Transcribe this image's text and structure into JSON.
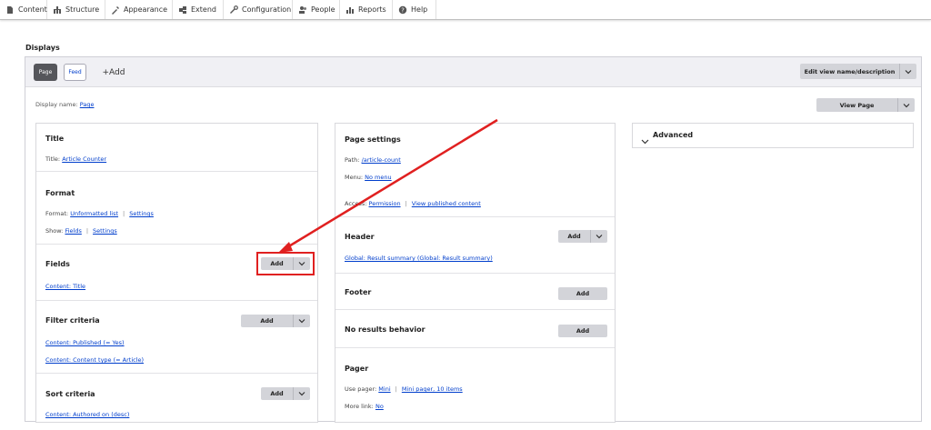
{
  "toolbar": {
    "items": [
      {
        "label": "Content",
        "icon": "content-icon"
      },
      {
        "label": "Structure",
        "icon": "structure-icon"
      },
      {
        "label": "Appearance",
        "icon": "appearance-icon"
      },
      {
        "label": "Extend",
        "icon": "extend-icon"
      },
      {
        "label": "Configuration",
        "icon": "configuration-icon"
      },
      {
        "label": "People",
        "icon": "people-icon"
      },
      {
        "label": "Reports",
        "icon": "reports-icon"
      },
      {
        "label": "Help",
        "icon": "help-icon"
      }
    ]
  },
  "displays": {
    "heading": "Displays",
    "tabs": {
      "page": "Page",
      "feed": "Feed",
      "add": "+Add"
    },
    "edit_view_button": "Edit view name/description",
    "display_name_label": "Display name:",
    "display_name_value": "Page",
    "view_page_button": "View Page"
  },
  "left": {
    "title": {
      "heading": "Title",
      "label": "Title:",
      "value": "Article Counter"
    },
    "format": {
      "heading": "Format",
      "format_label": "Format:",
      "format_value": "Unformatted list",
      "format_settings": "Settings",
      "show_label": "Show:",
      "show_value": "Fields",
      "show_settings": "Settings"
    },
    "fields": {
      "heading": "Fields",
      "add": "Add",
      "item": "Content: Title"
    },
    "filter": {
      "heading": "Filter criteria",
      "add": "Add",
      "items": [
        "Content: Published (= Yes)",
        "Content: Content type (= Article)"
      ]
    },
    "sort": {
      "heading": "Sort criteria",
      "add": "Add",
      "item": "Content: Authored on (desc)"
    }
  },
  "middle": {
    "page_settings": {
      "heading": "Page settings",
      "path_label": "Path:",
      "path_value": "/article-count",
      "menu_label": "Menu:",
      "menu_value": "No menu",
      "access_label": "Access:",
      "access_value": "Permission",
      "access_extra": "View published content"
    },
    "header": {
      "heading": "Header",
      "add": "Add",
      "item": "Global: Result summary (Global: Result summary)"
    },
    "footer": {
      "heading": "Footer",
      "add": "Add"
    },
    "no_results": {
      "heading": "No results behavior",
      "add": "Add"
    },
    "pager": {
      "heading": "Pager",
      "use_label": "Use pager:",
      "use_value": "Mini",
      "use_extra": "Mini pager, 10 items",
      "more_label": "More link:",
      "more_value": "No"
    }
  },
  "right": {
    "advanced": "Advanced"
  },
  "colors": {
    "link": "#003ecc",
    "annotation": "#e02020",
    "active_tab": "#55565b"
  }
}
